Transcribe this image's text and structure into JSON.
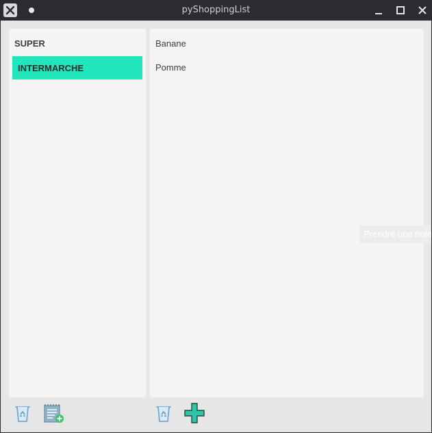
{
  "window": {
    "title": "pyShoppingList"
  },
  "stores": [
    {
      "label": "SUPER",
      "selected": false
    },
    {
      "label": "INTERMARCHE",
      "selected": true
    }
  ],
  "items": [
    {
      "label": "Banane"
    },
    {
      "label": "Pomme"
    }
  ],
  "ghost_tooltip": {
    "text": "Prendre une note"
  },
  "colors": {
    "accent": "#21e6bb",
    "panel": "#f4f4f4",
    "background": "#e6e6e6",
    "titlebar": "#2a2c31"
  },
  "icons": {
    "delete_store": "recycle-bin-icon",
    "add_store": "add-list-icon",
    "delete_item": "recycle-bin-icon",
    "add_item": "plus-icon"
  }
}
